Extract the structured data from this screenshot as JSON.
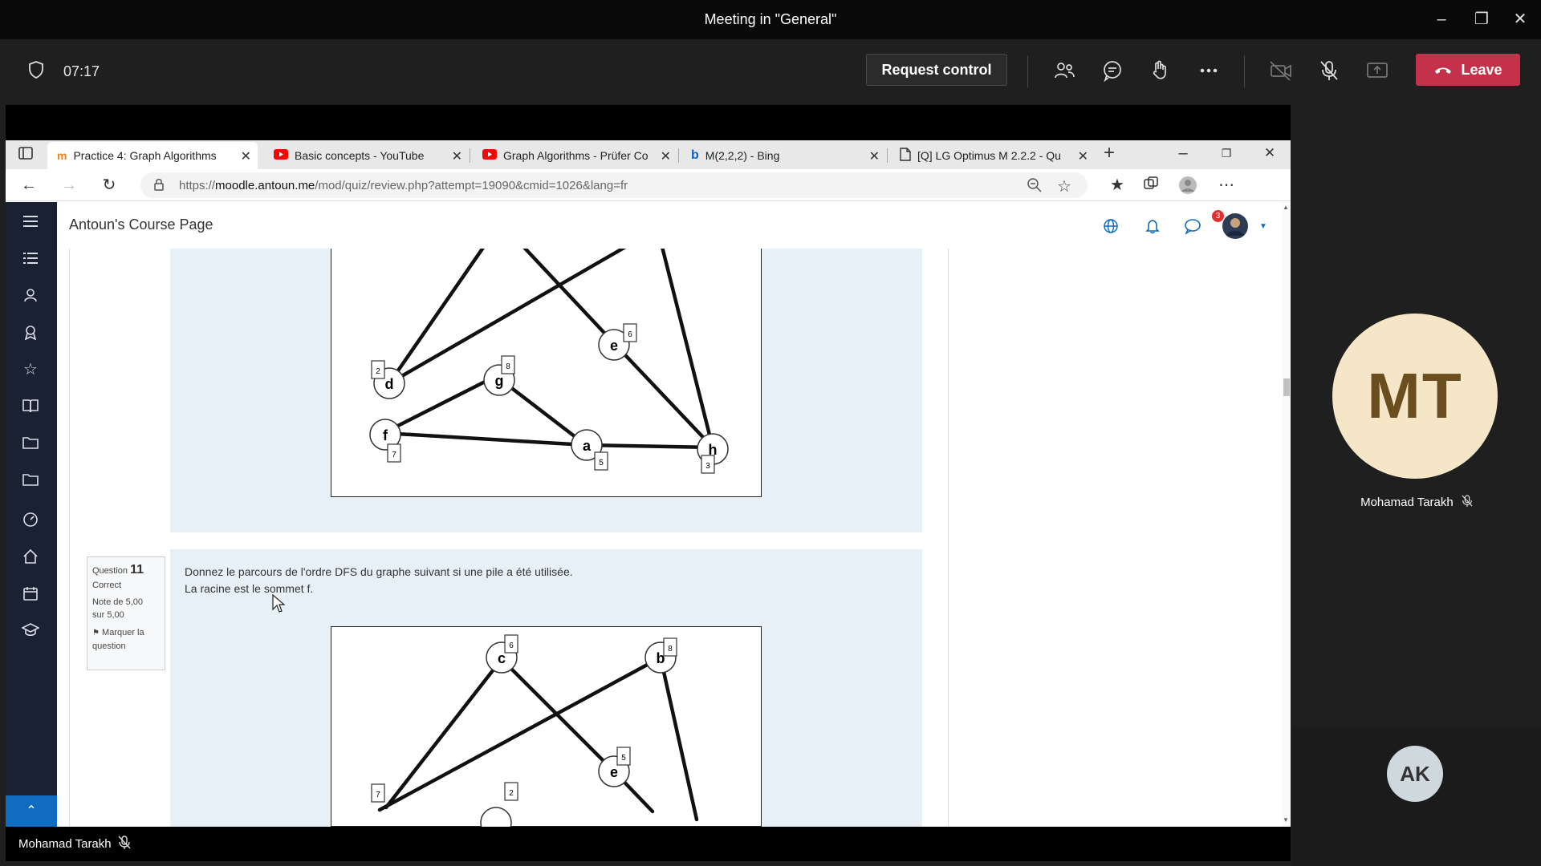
{
  "window": {
    "title": "Meeting in \"General\""
  },
  "meeting": {
    "timer": "07:17",
    "request_control_label": "Request control",
    "leave_label": "Leave"
  },
  "browser": {
    "tabs": [
      {
        "label": "Practice 4: Graph Algorithms",
        "icon": "moodle-icon"
      },
      {
        "label": "Basic concepts - YouTube",
        "icon": "youtube-icon"
      },
      {
        "label": "Graph Algorithms - Prüfer Co",
        "icon": "youtube-icon"
      },
      {
        "label": "M(2,2,2) - Bing",
        "icon": "bing-icon"
      },
      {
        "label": "[Q] LG Optimus M 2.2.2 - Qu",
        "icon": "document-icon"
      }
    ],
    "url_prefix": "https://",
    "url_domain": "moodle.antoun.me",
    "url_path": "/mod/quiz/review.php?attempt=19090&cmid=1026&lang=fr"
  },
  "moodle": {
    "site_name": "Antoun's Course Page",
    "notification_count": "3"
  },
  "question": {
    "number_prefix": "Question",
    "number": "11",
    "state": "Correct",
    "grade_line1": "Note de 5,00",
    "grade_line2": "sur 5,00",
    "flag_label_line1": "Marquer la",
    "flag_label_line2": "question",
    "text_line1": "Donnez le parcours de l'ordre DFS du graphe suivant si une pile a été utilisée.",
    "text_line2": "La racine est le sommet f."
  },
  "graph_top": {
    "nodes": [
      {
        "id": "d",
        "label": "d",
        "weight": "2"
      },
      {
        "id": "g",
        "label": "g",
        "weight": "8"
      },
      {
        "id": "e",
        "label": "e",
        "weight": "6"
      },
      {
        "id": "f",
        "label": "f",
        "weight": "7"
      },
      {
        "id": "a",
        "label": "a",
        "weight": "5"
      },
      {
        "id": "h",
        "label": "h",
        "weight": "3"
      }
    ]
  },
  "graph_bottom": {
    "nodes": [
      {
        "id": "c",
        "label": "c",
        "weight": "6"
      },
      {
        "id": "b",
        "label": "b",
        "weight": "8"
      },
      {
        "id": "e",
        "label": "e",
        "weight": "5"
      },
      {
        "id": "x1",
        "label": "",
        "weight": "7"
      },
      {
        "id": "x2",
        "label": "",
        "weight": "2"
      }
    ]
  },
  "participants": {
    "presenter_name": "Mohamad Tarakh",
    "presenter_initials": "MT",
    "self_initials": "AK"
  },
  "colors": {
    "leave": "#c4314b",
    "sidebar": "#1a2132",
    "accent": "#0f6cbf",
    "avatar_mt": "#f5e6c8"
  }
}
